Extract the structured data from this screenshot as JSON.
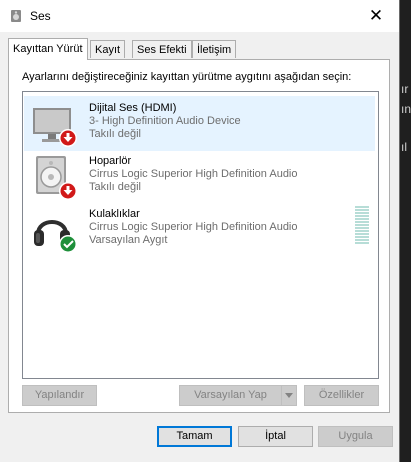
{
  "window": {
    "title": "Ses",
    "close_glyph": "✕"
  },
  "tabs": [
    {
      "label": "Kayıttan Yürüt",
      "active": true
    },
    {
      "label": "Kayıt",
      "active": false
    },
    {
      "label": "Ses Efekti",
      "active": false
    },
    {
      "label": "İletişim",
      "active": false
    }
  ],
  "instruction": "Ayarlarını değiştireceğiniz kayıttan yürütme aygıtını aşağıdan seçin:",
  "devices": [
    {
      "name": "Dijital Ses (HDMI)",
      "description": "3- High Definition Audio Device",
      "status": "Takılı değil",
      "icon": "monitor-icon",
      "badge": "down-arrow-badge-icon",
      "selected": true
    },
    {
      "name": "Hoparlör",
      "description": "Cirrus Logic Superior High Definition Audio",
      "status": "Takılı değil",
      "icon": "speaker-icon",
      "badge": "down-arrow-badge-icon",
      "selected": false
    },
    {
      "name": "Kulaklıklar",
      "description": "Cirrus Logic Superior High Definition Audio",
      "status": "Varsayılan Aygıt",
      "icon": "headphones-icon",
      "badge": "checkmark-badge-icon",
      "selected": false
    }
  ],
  "buttons": {
    "configure": "Yapılandır",
    "set_default": "Varsayılan Yap",
    "properties": "Özellikler",
    "ok": "Tamam",
    "cancel": "İptal",
    "apply": "Uygula"
  },
  "background_text": {
    "fragment1": "ır",
    "fragment2": "ın",
    "fragment3": "ıl"
  },
  "colors": {
    "selection": "#e5f3ff",
    "accent": "#0078d7",
    "error_badge": "#d11919",
    "ok_badge": "#1e8f3a"
  }
}
